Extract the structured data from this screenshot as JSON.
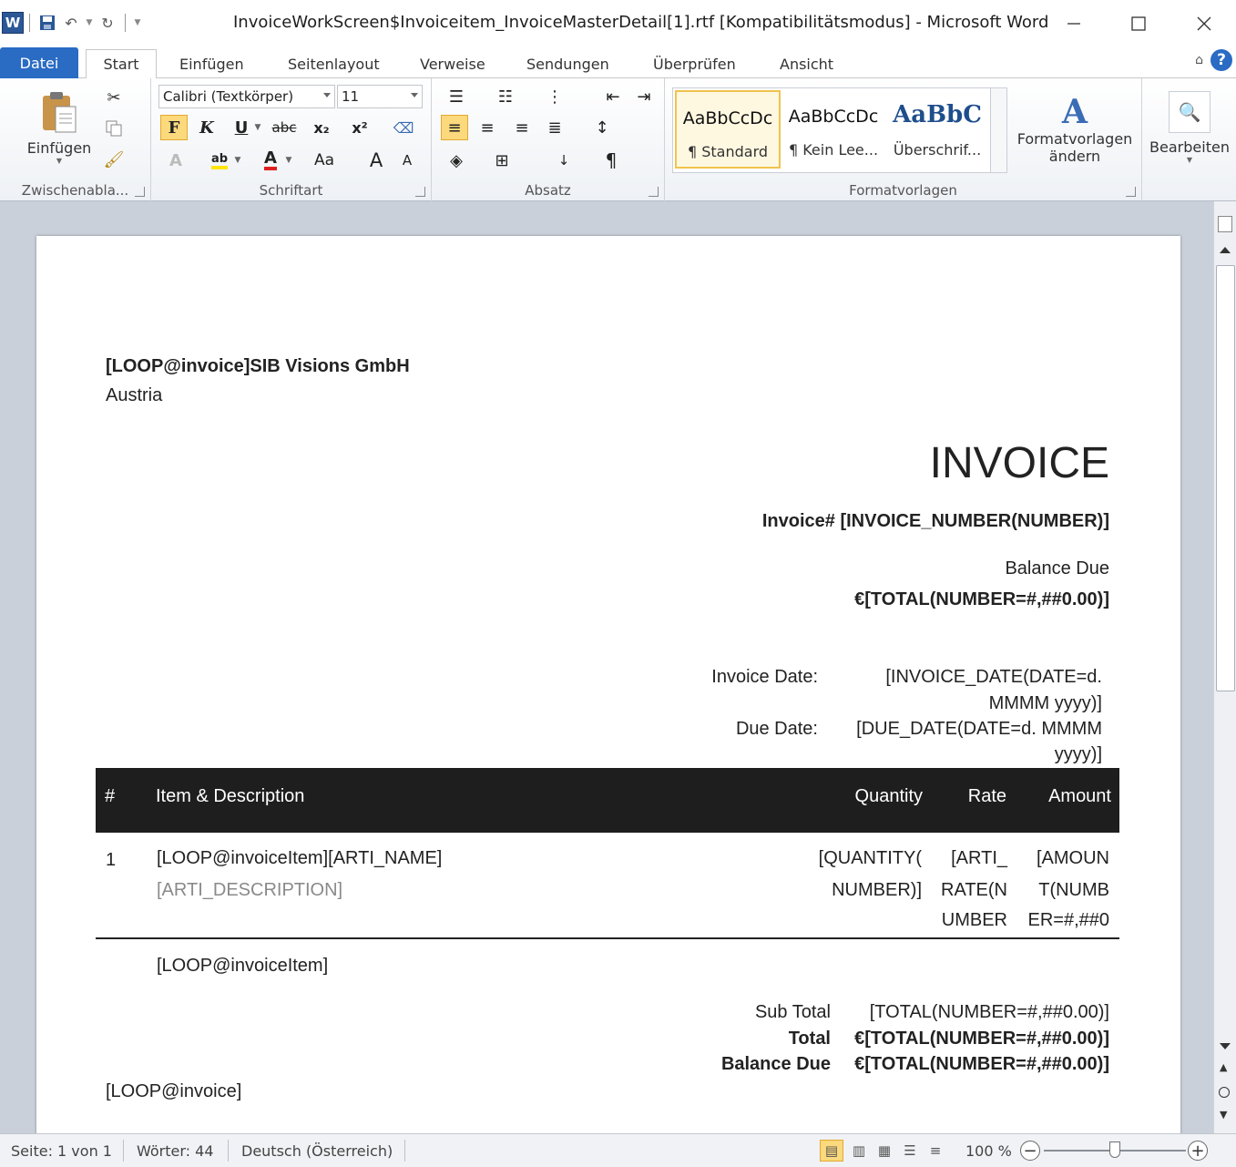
{
  "window": {
    "title": "InvoiceWorkScreen$Invoiceitem_InvoiceMasterDetail[1].rtf [Kompatibilitätsmodus]  -  Microsoft Word",
    "app_icon": "W"
  },
  "tabs": [
    "Datei",
    "Start",
    "Einfügen",
    "Seitenlayout",
    "Verweise",
    "Sendungen",
    "Überprüfen",
    "Ansicht"
  ],
  "ribbon": {
    "clipboard": {
      "paste_label": "Einfügen",
      "group_label": "Zwischenabla..."
    },
    "font": {
      "font_name": "Calibri (Textkörper)",
      "font_size": "11",
      "bold_label": "F",
      "italic_label": "K",
      "underline_label": "U",
      "strike_label": "abc",
      "subscript_label": "x₂",
      "superscript_label": "x²",
      "change_case_label": "Aa",
      "grow_label": "A",
      "shrink_label": "A",
      "group_label": "Schriftart"
    },
    "paragraph": {
      "group_label": "Absatz"
    },
    "styles": {
      "items": [
        {
          "sample": "AaBbCcDc",
          "name": "¶ Standard"
        },
        {
          "sample": "AaBbCcDc",
          "name": "¶ Kein Lee..."
        },
        {
          "sample": "AaBbC",
          "name": "Überschrif..."
        }
      ],
      "change_styles_label_1": "Formatvorlagen",
      "change_styles_label_2": "ändern",
      "group_label": "Formatvorlagen"
    },
    "editing": {
      "label": "Bearbeiten"
    }
  },
  "document": {
    "company_line": "[LOOP@invoice]SIB Visions GmbH",
    "country": "Austria",
    "heading": "INVOICE",
    "invoice_number": "Invoice# [INVOICE_NUMBER(NUMBER)]",
    "balance_due_label": "Balance Due",
    "balance_due_value": "€[TOTAL(NUMBER=#,##0.00)]",
    "invoice_date_label": "Invoice Date:",
    "invoice_date_value_1": "[INVOICE_DATE(DATE=d.",
    "invoice_date_value_2": "MMMM yyyy)]",
    "due_date_label": "Due Date:",
    "due_date_value_1": "[DUE_DATE(DATE=d. MMMM",
    "due_date_value_2": "yyyy)]",
    "table": {
      "headers": [
        "#",
        "Item & Description",
        "Quantity",
        "Rate",
        "Amount"
      ],
      "row": {
        "num": "1",
        "name": "[LOOP@invoiceItem][ARTI_NAME]",
        "description": "[ARTI_DESCRIPTION]",
        "quantity_1": "[QUANTITY(",
        "quantity_2": "NUMBER)]",
        "rate_1": "[ARTI_",
        "rate_2": "RATE(N",
        "rate_3": "UMBER",
        "amount_1": "[AMOUN",
        "amount_2": "T(NUMB",
        "amount_3": "ER=#,##0"
      }
    },
    "loop_item_end": "[LOOP@invoiceItem]",
    "subtotal_label": "Sub Total",
    "subtotal_value": "[TOTAL(NUMBER=#,##0.00)]",
    "total_label": "Total",
    "total_value": "€[TOTAL(NUMBER=#,##0.00)]",
    "balance_label": "Balance Due",
    "balance_value": "€[TOTAL(NUMBER=#,##0.00)]",
    "loop_invoice_end": "[LOOP@invoice]"
  },
  "statusbar": {
    "page": "Seite: 1 von 1",
    "words": "Wörter: 44",
    "language": "Deutsch (Österreich)",
    "zoom": "100 %"
  }
}
